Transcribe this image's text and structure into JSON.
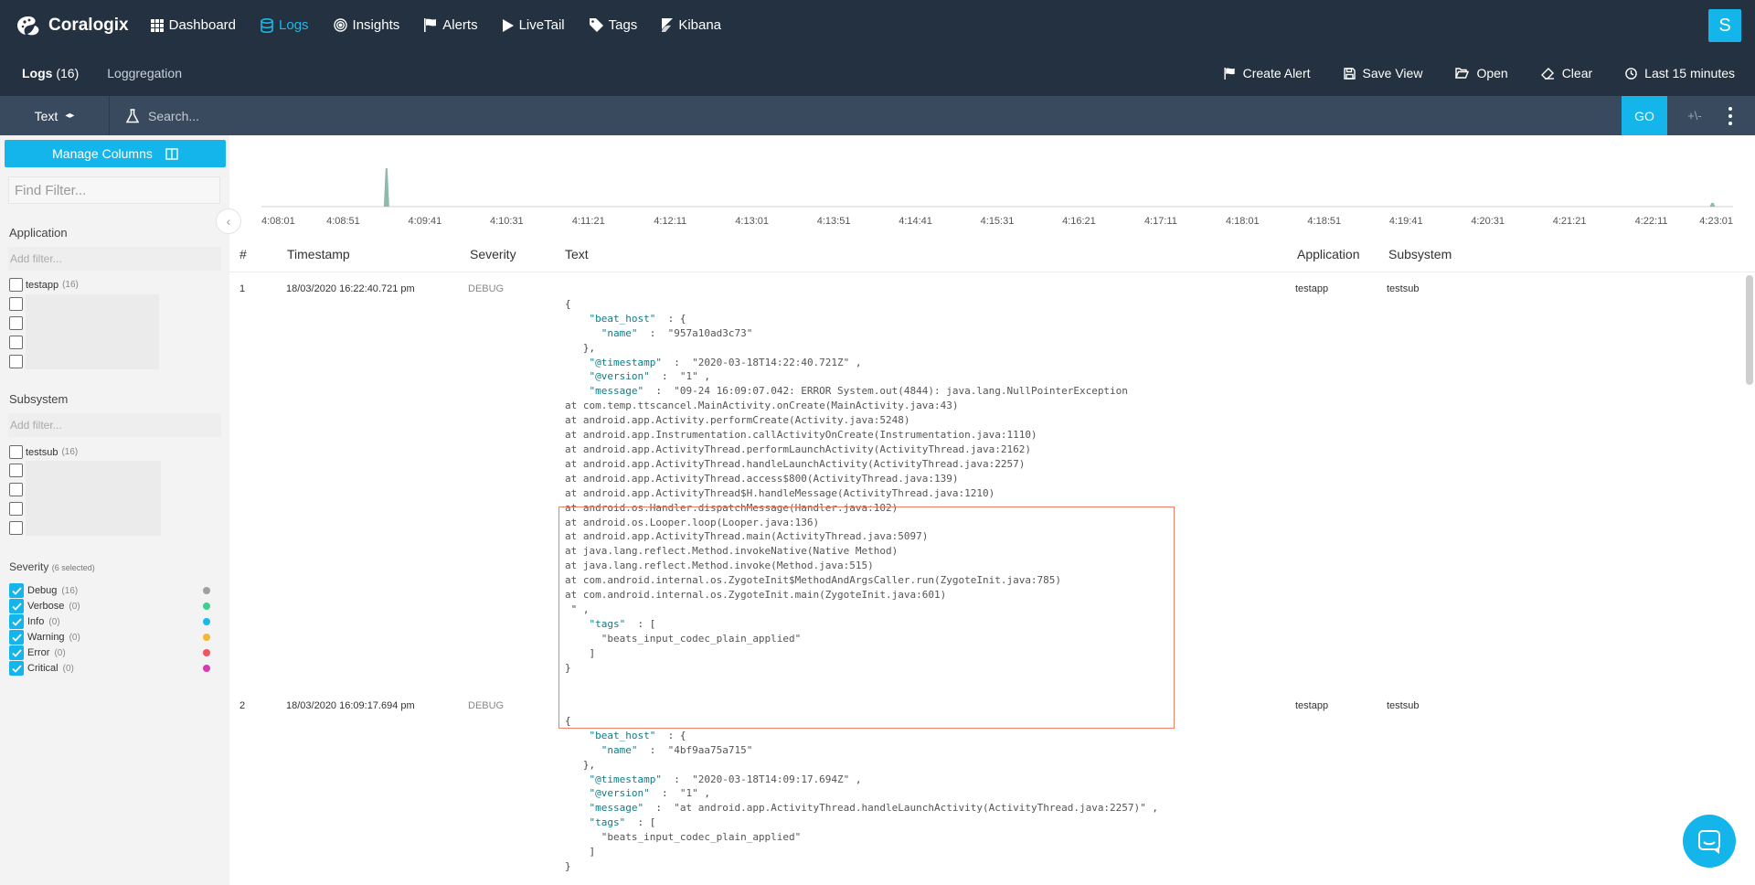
{
  "brand": {
    "name": "Coralogix"
  },
  "nav": [
    {
      "label": "Dashboard",
      "icon": "grid-icon"
    },
    {
      "label": "Logs",
      "icon": "database-icon",
      "active": true
    },
    {
      "label": "Insights",
      "icon": "target-icon"
    },
    {
      "label": "Alerts",
      "icon": "flag-icon"
    },
    {
      "label": "LiveTail",
      "icon": "play-icon"
    },
    {
      "label": "Tags",
      "icon": "tag-icon"
    },
    {
      "label": "Kibana",
      "icon": "kibana-icon"
    }
  ],
  "user": {
    "initial": "S"
  },
  "subnav": {
    "logs_label": "Logs",
    "logs_count": "(16)",
    "loggregation": "Loggregation",
    "actions": {
      "create_alert": "Create Alert",
      "save_view": "Save View",
      "open": "Open",
      "clear": "Clear",
      "time_range": "Last 15 minutes"
    }
  },
  "search": {
    "mode": "Text",
    "placeholder": "Search...",
    "go": "GO",
    "plus_minus": "+\\-"
  },
  "sidebar": {
    "manage_columns": "Manage Columns",
    "find_filter_placeholder": "Find Filter...",
    "application": {
      "title": "Application",
      "placeholder": "Add filter...",
      "items": [
        {
          "label": "testapp",
          "count": "(16)"
        }
      ]
    },
    "subsystem": {
      "title": "Subsystem",
      "placeholder": "Add filter...",
      "items": [
        {
          "label": "testsub",
          "count": "(16)"
        }
      ]
    },
    "severity": {
      "title": "Severity",
      "selected": "(6 selected)",
      "items": [
        {
          "label": "Debug",
          "count": "(16)",
          "color": "#a0a0a0"
        },
        {
          "label": "Verbose",
          "count": "(0)",
          "color": "#3fcf8e"
        },
        {
          "label": "Info",
          "count": "(0)",
          "color": "#1cb8e8"
        },
        {
          "label": "Warning",
          "count": "(0)",
          "color": "#f5b731"
        },
        {
          "label": "Error",
          "count": "(0)",
          "color": "#f2545b"
        },
        {
          "label": "Critical",
          "count": "(0)",
          "color": "#d63bb4"
        }
      ]
    }
  },
  "timeline": {
    "ticks": [
      "4:08:01",
      "4:08:51",
      "4:09:41",
      "4:10:31",
      "4:11:21",
      "4:12:11",
      "4:13:01",
      "4:13:51",
      "4:14:41",
      "4:15:31",
      "4:16:21",
      "4:17:11",
      "4:18:01",
      "4:18:51",
      "4:19:41",
      "4:20:31",
      "4:21:21",
      "4:22:11",
      "4:23:01"
    ],
    "spike_positions": [
      0.085,
      0.986
    ],
    "spike_levels": [
      1.0,
      0.1
    ]
  },
  "table": {
    "columns": {
      "num": "#",
      "timestamp": "Timestamp",
      "severity": "Severity",
      "text": "Text",
      "application": "Application",
      "subsystem": "Subsystem"
    },
    "rows": [
      {
        "num": "1",
        "timestamp": "18/03/2020 16:22:40.721 pm",
        "severity": "DEBUG",
        "application": "testapp",
        "subsystem": "testsub",
        "beat_host_name": "\"957a10ad3c73\"",
        "timestamp_val": "\"2020-03-18T14:22:40.721Z\"",
        "version_val": "\"1\"",
        "message_first": "\"09-24 16:09:07.042: ERROR System.out(4844): java.lang.NullPointerException",
        "message_lines": [
          "at com.temp.ttscancel.MainActivity.onCreate(MainActivity.java:43)",
          "at android.app.Activity.performCreate(Activity.java:5248)",
          "at android.app.Instrumentation.callActivityOnCreate(Instrumentation.java:1110)",
          "at android.app.ActivityThread.performLaunchActivity(ActivityThread.java:2162)",
          "at android.app.ActivityThread.handleLaunchActivity(ActivityThread.java:2257)",
          "at android.app.ActivityThread.access$800(ActivityThread.java:139)",
          "at android.app.ActivityThread$H.handleMessage(ActivityThread.java:1210)",
          "at android.os.Handler.dispatchMessage(Handler.java:102)",
          "at android.os.Looper.loop(Looper.java:136)",
          "at android.app.ActivityThread.main(ActivityThread.java:5097)",
          "at java.lang.reflect.Method.invokeNative(Native Method)",
          "at java.lang.reflect.Method.invoke(Method.java:515)",
          "at com.android.internal.os.ZygoteInit$MethodAndArgsCaller.run(ZygoteInit.java:785)",
          "at com.android.internal.os.ZygoteInit.main(ZygoteInit.java:601)"
        ],
        "tags_val": "\"beats_input_codec_plain_applied\""
      },
      {
        "num": "2",
        "timestamp": "18/03/2020 16:09:17.694 pm",
        "severity": "DEBUG",
        "application": "testapp",
        "subsystem": "testsub",
        "beat_host_name": "\"4bf9aa75a715\"",
        "timestamp_val": "\"2020-03-18T14:09:17.694Z\"",
        "version_val": "\"1\"",
        "message_first": "\"at android.app.ActivityThread.handleLaunchActivity(ActivityThread.java:2257)\"",
        "tags_val": "\"beats_input_codec_plain_applied\""
      }
    ]
  },
  "json_keys": {
    "beat_host": "\"beat_host\"",
    "name": "\"name\"",
    "timestamp": "\"@timestamp\"",
    "version": "\"@version\"",
    "message": "\"message\"",
    "tags": "\"tags\""
  }
}
